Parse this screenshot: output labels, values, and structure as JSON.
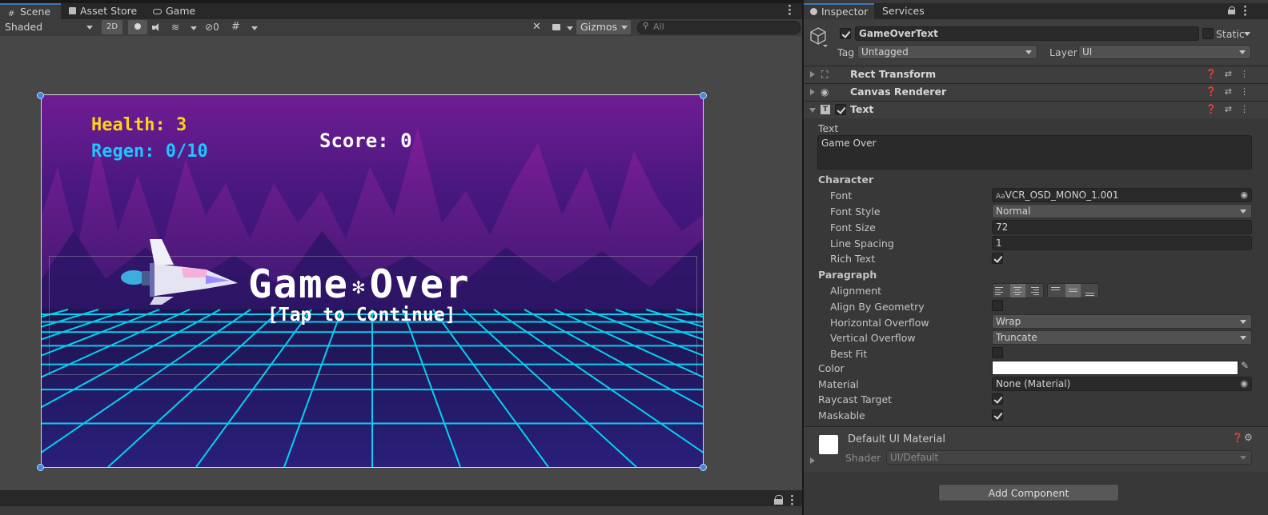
{
  "scene_tabs": {
    "scene": "Scene",
    "asset_store": "Asset Store",
    "game": "Game"
  },
  "scene_toolbar": {
    "shading_mode": "Shaded",
    "mode_2d": "2D",
    "hidden_count": "0",
    "gizmos": "Gizmos",
    "search_placeholder": "All"
  },
  "game": {
    "health": "Health: 3",
    "regen": "Regen: 0/10",
    "score": "Score: 0",
    "game_over_1": "Game",
    "game_over_sep": "✻",
    "game_over_2": "Over",
    "tap": "[Tap to Continue]"
  },
  "inspector_tabs": {
    "inspector": "Inspector",
    "services": "Services"
  },
  "object": {
    "name": "GameOverText",
    "static_label": "Static",
    "tag_label": "Tag",
    "tag": "Untagged",
    "layer_label": "Layer",
    "layer": "UI"
  },
  "components": {
    "rect_transform": "Rect Transform",
    "canvas_renderer": "Canvas Renderer",
    "text": "Text"
  },
  "text_component": {
    "text_label": "Text",
    "text_value": "Game Over",
    "character_label": "Character",
    "font_label": "Font",
    "font_value": "VCR_OSD_MONO_1.001",
    "font_style_label": "Font Style",
    "font_style_value": "Normal",
    "font_size_label": "Font Size",
    "font_size_value": "72",
    "line_spacing_label": "Line Spacing",
    "line_spacing_value": "1",
    "rich_text_label": "Rich Text",
    "paragraph_label": "Paragraph",
    "alignment_label": "Alignment",
    "align_by_geometry_label": "Align By Geometry",
    "horizontal_overflow_label": "Horizontal Overflow",
    "horizontal_overflow_value": "Wrap",
    "vertical_overflow_label": "Vertical Overflow",
    "vertical_overflow_value": "Truncate",
    "best_fit_label": "Best Fit",
    "color_label": "Color",
    "color_value": "#FFFFFF",
    "material_label": "Material",
    "material_value": "None (Material)",
    "raycast_label": "Raycast Target",
    "maskable_label": "Maskable"
  },
  "material_block": {
    "name": "Default UI Material",
    "shader_label": "Shader",
    "shader_value": "UI/Default"
  },
  "add_component": "Add Component",
  "colors": {
    "health": "#ffd21a",
    "regen": "#20c4ff",
    "grid": "#00e5ff",
    "sky_top": "#5b1a86",
    "selection": "#3d87e6"
  }
}
